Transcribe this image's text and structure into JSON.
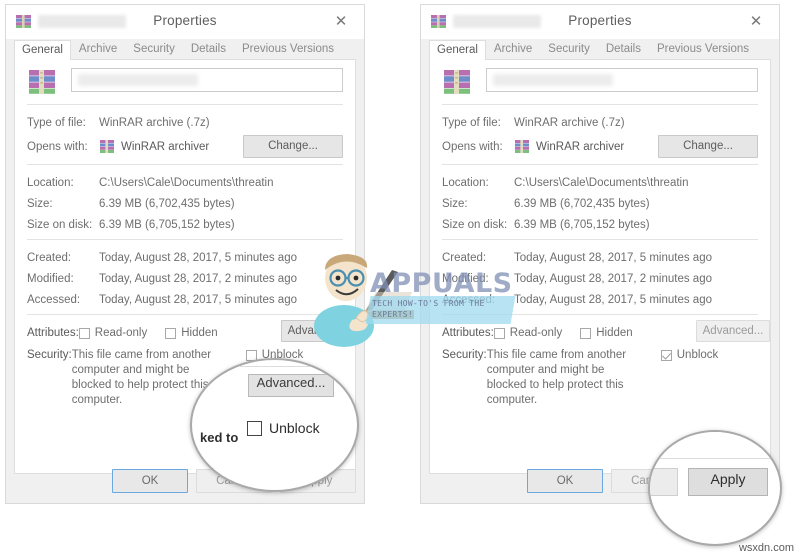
{
  "window_title": "Properties",
  "close_icon": "✕",
  "tabs": [
    "General",
    "Archive",
    "Security",
    "Details",
    "Previous Versions"
  ],
  "active_tab": "General",
  "fields": {
    "type_label": "Type of file:",
    "type_value": "WinRAR archive (.7z)",
    "opens_label": "Opens with:",
    "opens_value": "WinRAR archiver",
    "change_button": "Change...",
    "location_label": "Location:",
    "location_value": "C:\\Users\\Cale\\Documents\\threatin",
    "size_label": "Size:",
    "size_value": "6.39 MB (6,702,435 bytes)",
    "size_on_disk_label": "Size on disk:",
    "size_on_disk_value": "6.39 MB (6,705,152 bytes)",
    "created_label": "Created:",
    "created_value": "Today, August 28, 2017, 5 minutes ago",
    "modified_label": "Modified:",
    "modified_value": "Today, August 28, 2017, 2 minutes ago",
    "accessed_label": "Accessed:",
    "accessed_value": "Today, August 28, 2017, 5 minutes ago",
    "attributes_label": "Attributes:",
    "readonly_label": "Read-only",
    "hidden_label": "Hidden",
    "advanced_button": "Advanced...",
    "security_label": "Security:",
    "security_text": "This file came from another computer and might be blocked to help protect this computer.",
    "unblock_label": "Unblock"
  },
  "footer": {
    "ok": "OK",
    "cancel": "Cancel",
    "apply": "Apply"
  },
  "left_dialog": {
    "unblock_checked": false,
    "readonly_checked": false,
    "hidden_checked": false,
    "advanced_enabled": true
  },
  "right_dialog": {
    "unblock_checked": true,
    "readonly_checked": false,
    "hidden_checked": false,
    "advanced_enabled": false
  },
  "magnifier_left": {
    "advanced_button": "Advanced...",
    "unblock_label": "Unblock",
    "fragment_text": "ked to",
    "cancel_label": "Cancel"
  },
  "magnifier_right": {
    "apply_button": "Apply"
  },
  "watermark": {
    "brand": "APPUALS",
    "tagline": "TECH HOW-TO'S FROM THE EXPERTS!"
  },
  "site_credit": "wsxdn.com",
  "colors": {
    "dialog_bg": "#f0f0f0",
    "panel_bg": "#ffffff",
    "text": "#6e6e6e",
    "focus_blue": "#6aa8e0",
    "watermark_blue": "#7f8fb5",
    "watermark_bar": "#9fd9ef"
  }
}
